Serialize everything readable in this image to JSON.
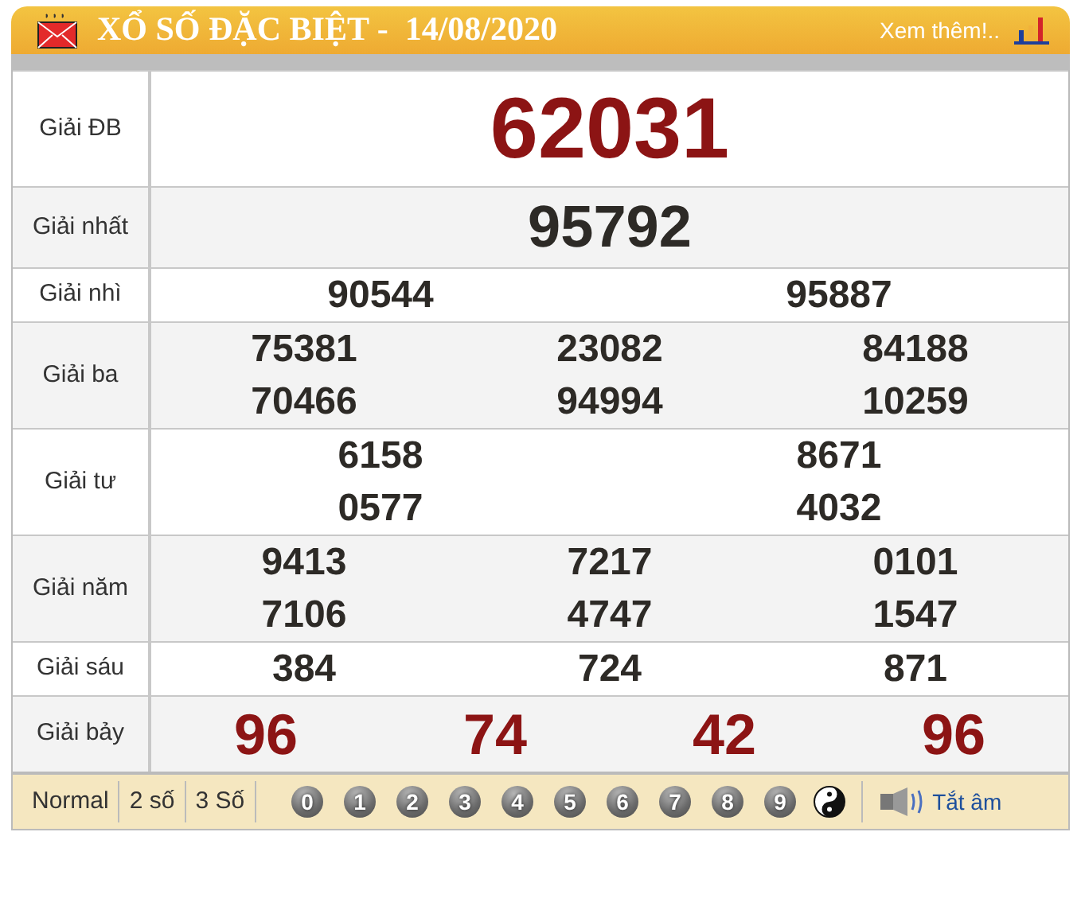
{
  "header": {
    "title": "XỔ SỐ ĐẶC BIỆT -  14/08/2020",
    "more_link": "Xem thêm!.."
  },
  "prizes": [
    {
      "label": "Giải ĐB",
      "kind": "special",
      "columns": [
        [
          "62031"
        ]
      ]
    },
    {
      "label": "Giải nhất",
      "kind": "first",
      "columns": [
        [
          "95792"
        ]
      ]
    },
    {
      "label": "Giải nhì",
      "kind": "normal",
      "columns": [
        [
          "90544"
        ],
        [
          "95887"
        ]
      ]
    },
    {
      "label": "Giải ba",
      "kind": "normal",
      "columns": [
        [
          "75381",
          "70466"
        ],
        [
          "23082",
          "94994"
        ],
        [
          "84188",
          "10259"
        ]
      ]
    },
    {
      "label": "Giải tư",
      "kind": "normal",
      "columns": [
        [
          "6158",
          "0577"
        ],
        [
          "8671",
          "4032"
        ]
      ]
    },
    {
      "label": "Giải năm",
      "kind": "normal",
      "columns": [
        [
          "9413",
          "7106"
        ],
        [
          "7217",
          "4747"
        ],
        [
          "0101",
          "1547"
        ]
      ]
    },
    {
      "label": "Giải sáu",
      "kind": "normal",
      "columns": [
        [
          "384"
        ],
        [
          "724"
        ],
        [
          "871"
        ]
      ]
    },
    {
      "label": "Giải bảy",
      "kind": "last",
      "columns": [
        [
          "96"
        ],
        [
          "74"
        ],
        [
          "42"
        ],
        [
          "96"
        ]
      ]
    }
  ],
  "footer": {
    "modes": [
      "Normal",
      "2 số",
      "3 Số"
    ],
    "digits": [
      "0",
      "1",
      "2",
      "3",
      "4",
      "5",
      "6",
      "7",
      "8",
      "9"
    ],
    "mute_link": "Tắt âm"
  }
}
